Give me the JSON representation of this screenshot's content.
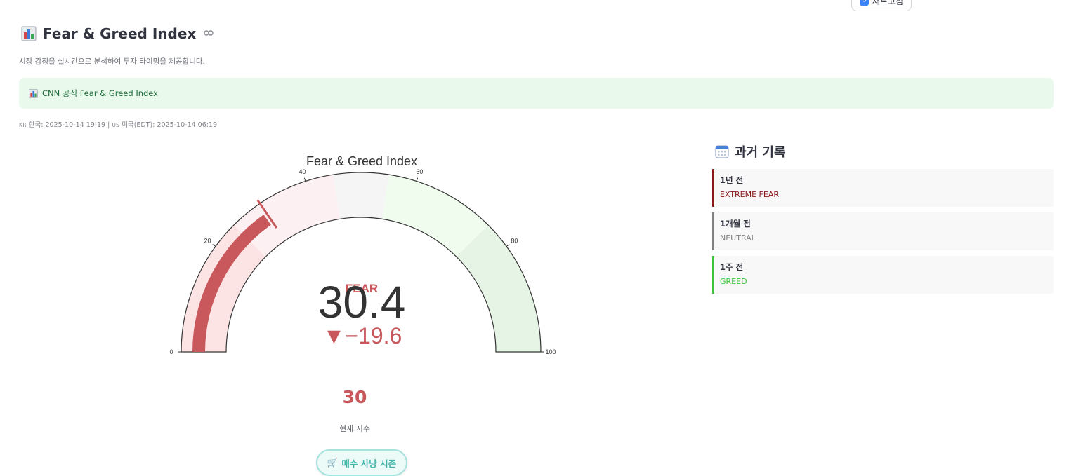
{
  "header": {
    "refresh_label": "새로고침",
    "title": "Fear & Greed Index",
    "subtitle": "시장 감정을 실시간으로 분석하여 투자 타이밍을 제공합니다.",
    "title_icon": "bar-chart-emoji",
    "link_icon": "link-icon"
  },
  "banner": {
    "icon": "bar-chart-emoji",
    "text": "CNN 공식 Fear & Greed Index"
  },
  "timestamp": {
    "kr_code": "KR",
    "kr_text": "한국: 2025-10-14 19:19 |",
    "us_code": "US",
    "us_text": "미국(EDT): 2025-10-14 06:19"
  },
  "gauge": {
    "title": "Fear & Greed Index",
    "value_text": "30.4",
    "delta_text": "▼−19.6",
    "state_label": "FEAR",
    "ticks": [
      "0",
      "20",
      "40",
      "60",
      "80",
      "100"
    ],
    "colors": {
      "bar": "#c8585c",
      "delta": "#c8585c",
      "band_extreme_fear": "#fde4e4",
      "band_fear": "#fdf0f3",
      "band_neutral": "#f5f5f6",
      "band_greed": "#effcee",
      "band_extreme_greed": "#e6f4e6"
    }
  },
  "chart_data": {
    "type": "gauge",
    "title": "Fear & Greed Index",
    "value": 30.4,
    "delta": -19.6,
    "range": [
      0,
      100
    ],
    "ticks": [
      0,
      20,
      40,
      60,
      80,
      100
    ],
    "bands": [
      {
        "from": 0,
        "to": 25
      },
      {
        "from": 25,
        "to": 45
      },
      {
        "from": 45,
        "to": 55
      },
      {
        "from": 55,
        "to": 75
      },
      {
        "from": 75,
        "to": 100
      }
    ],
    "threshold": 31
  },
  "current": {
    "value": "30",
    "label": "현재 지수",
    "season_icon": "shopping-cart-emoji",
    "season_label": "매수 사냥 시즌"
  },
  "history": {
    "title": "과거 기록",
    "icon": "calendar-icon",
    "items": [
      {
        "period": "1년 전",
        "state": "EXTREME FEAR",
        "color": "#8b1a1a"
      },
      {
        "period": "1개월 전",
        "state": "NEUTRAL",
        "color": "#808080"
      },
      {
        "period": "1주 전",
        "state": "GREED",
        "color": "#3cc23c"
      }
    ]
  }
}
